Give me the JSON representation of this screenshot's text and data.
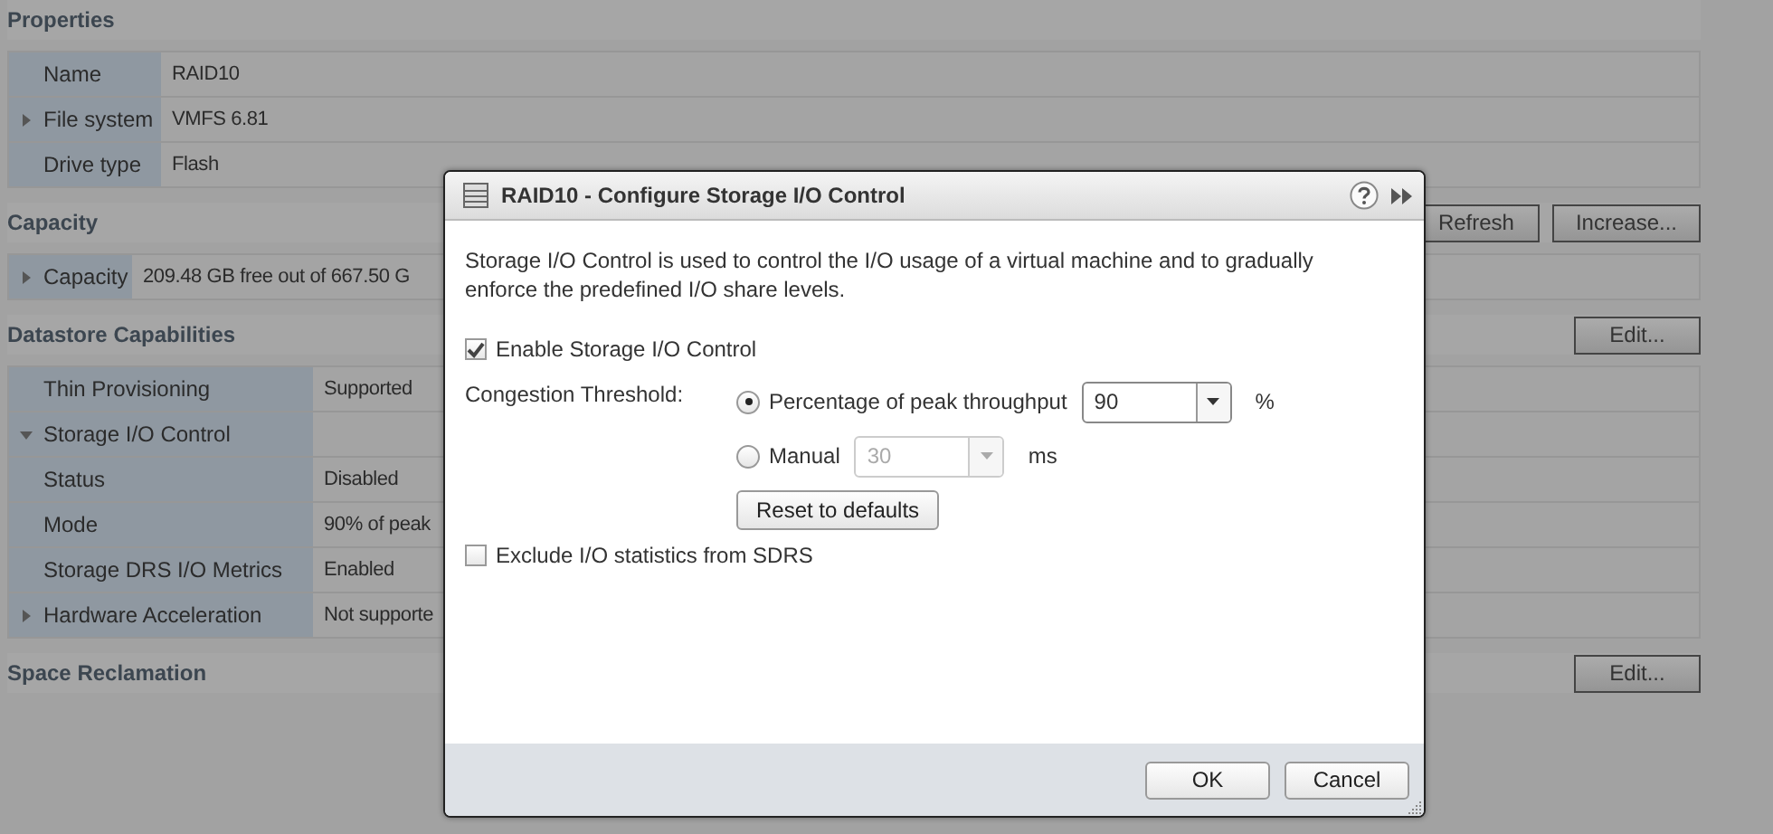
{
  "sections": [
    {
      "title": "Properties",
      "rows": [
        {
          "label": "Name",
          "value": "RAID10",
          "kind": "leaf"
        },
        {
          "label": "File system",
          "value": "VMFS 6.81",
          "kind": "group",
          "expanded": false
        },
        {
          "label": "Drive type",
          "value": "Flash",
          "kind": "leaf"
        }
      ]
    },
    {
      "title": "Capacity",
      "buttons": [
        "Refresh",
        "Increase..."
      ],
      "rows": [
        {
          "label": "Capacity",
          "value": "209.48 GB free out of 667.50 G",
          "kind": "group",
          "expanded": false
        }
      ]
    },
    {
      "title": "Datastore Capabilities",
      "buttons": [
        "Edit..."
      ],
      "rows": [
        {
          "label": "Thin Provisioning",
          "value": "Supported",
          "kind": "leaf"
        },
        {
          "label": "Storage I/O Control",
          "value": "",
          "kind": "group",
          "expanded": true
        },
        {
          "label": "Status",
          "value": "Disabled",
          "kind": "leaf"
        },
        {
          "label": "Mode",
          "value": "90% of peak",
          "kind": "leaf"
        },
        {
          "label": "Storage DRS I/O Metrics",
          "value": "Enabled",
          "kind": "leaf"
        },
        {
          "label": "Hardware Acceleration",
          "value": "Not supporte",
          "kind": "group",
          "expanded": false
        }
      ]
    },
    {
      "title": "Space Reclamation",
      "buttons": [
        "Edit..."
      ]
    }
  ],
  "dialog": {
    "title": "RAID10 - Configure Storage I/O Control",
    "description": "Storage I/O Control is used to control the I/O usage of a virtual machine and to gradually enforce the predefined I/O share levels.",
    "enable": {
      "label": "Enable Storage I/O Control",
      "checked": true
    },
    "threshold": {
      "label": "Congestion Threshold:",
      "options": [
        {
          "label": "Percentage of peak throughput",
          "selected": true,
          "value": "90",
          "unit": "%",
          "disabled": false
        },
        {
          "label": "Manual",
          "selected": false,
          "value": "30",
          "unit": "ms",
          "disabled": true
        }
      ]
    },
    "reset": "Reset to defaults",
    "exclude": {
      "label": "Exclude I/O statistics from SDRS",
      "checked": false
    },
    "buttons": [
      "OK",
      "Cancel"
    ]
  }
}
